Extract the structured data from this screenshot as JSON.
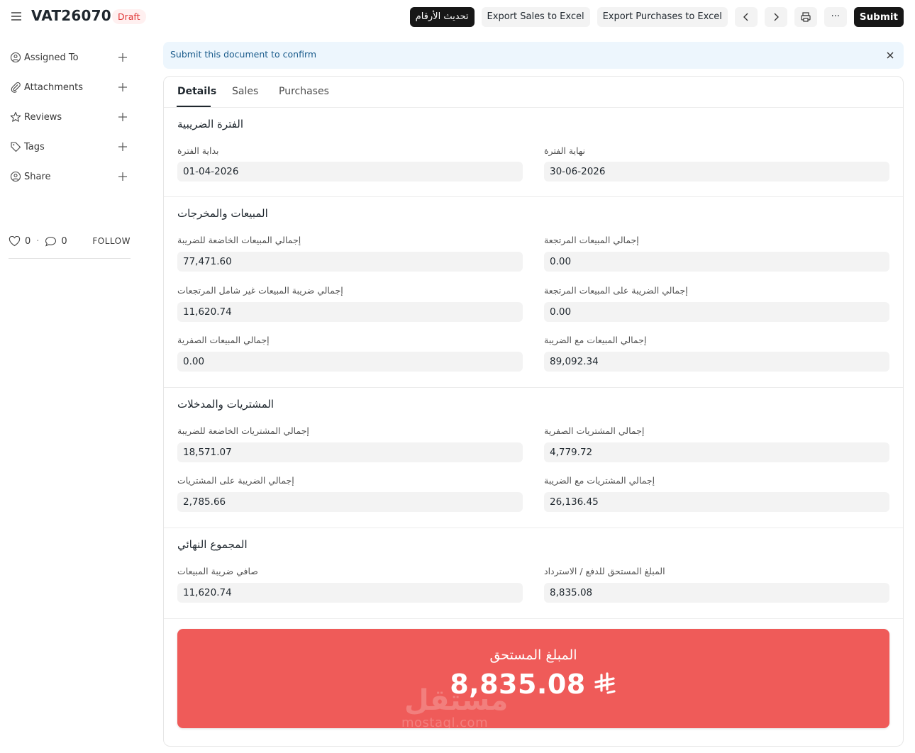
{
  "header": {
    "title": "VAT26070",
    "status": "Draft",
    "update_label": "تحديث الأرقام",
    "export_sales_label": "Export Sales to Excel",
    "export_purchases_label": "Export Purchases to Excel",
    "more_label": "···",
    "submit_label": "Submit"
  },
  "sidebar": {
    "items": [
      {
        "label": "Assigned To",
        "icon": "user-plus-icon"
      },
      {
        "label": "Attachments",
        "icon": "paperclip-icon"
      },
      {
        "label": "Reviews",
        "icon": "star-icon"
      },
      {
        "label": "Tags",
        "icon": "tag-icon"
      },
      {
        "label": "Share",
        "icon": "share-user-icon"
      }
    ],
    "likes": "0",
    "comments": "0",
    "follow_label": "FOLLOW"
  },
  "alert": {
    "message": "Submit this document to confirm"
  },
  "tabs": [
    "Details",
    "Sales",
    "Purchases"
  ],
  "period": {
    "title": "الفترة الضريبية",
    "start_label": "بداية الفترة",
    "start_value": "01-04-2026",
    "end_label": "نهاية الفترة",
    "end_value": "30-06-2026"
  },
  "sales": {
    "title": "المبيعات والمخرجات",
    "taxable_label": "إجمالي المبيعات الخاضعة للضريبة",
    "taxable_value": "77,471.60",
    "returned_label": "إجمالي المبيعات المرتجعة",
    "returned_value": "0.00",
    "vat_excl_returns_label": "إجمالي ضريبة المبيعات غير شامل المرتجعات",
    "vat_excl_returns_value": "11,620.74",
    "returned_tax_label": "إجمالي الضريبة على المبيعات المرتجعة",
    "returned_tax_value": "0.00",
    "zero_rated_label": "إجمالي المبيعات الصفرية",
    "zero_rated_value": "0.00",
    "with_tax_label": "إجمالي المبيعات مع الضريبة",
    "with_tax_value": "89,092.34"
  },
  "purchases": {
    "title": "المشتريات والمدخلات",
    "taxable_label": "إجمالي المشتريات الخاضعة للضريبة",
    "taxable_value": "18,571.07",
    "zero_rated_label": "إجمالي المشتريات الصفرية",
    "zero_rated_value": "4,779.72",
    "tax_label": "إجمالي الضريبة على المشتريات",
    "tax_value": "2,785.66",
    "with_tax_label": "إجمالي المشتريات مع الضريبة",
    "with_tax_value": "26,136.45"
  },
  "totals": {
    "title": "المجموع النهائي",
    "net_vat_label": "صافي ضريبة المبيعات",
    "net_vat_value": "11,620.74",
    "due_label": "المبلغ المستحق للدفع / الاسترداد",
    "due_value": "8,835.08"
  },
  "amount_box": {
    "label": "المبلغ المستحق",
    "value": "8,835.08",
    "currency_icon": "saudi-riyal-icon",
    "color": "#ef5b59"
  },
  "watermark": {
    "main": "مستقل",
    "sub": "mostaql.com"
  }
}
